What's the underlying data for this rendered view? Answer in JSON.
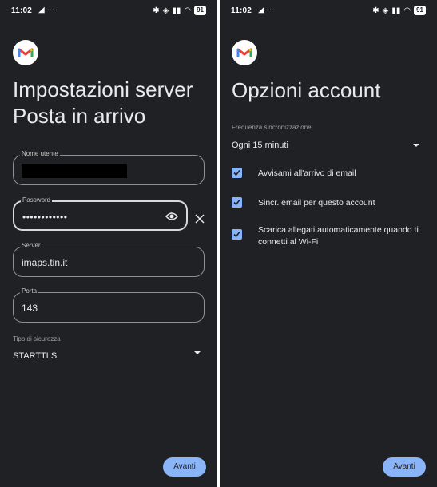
{
  "status_bar": {
    "time": "11:02",
    "left_icons": "◢ ···",
    "battery": "91"
  },
  "left": {
    "title": "Impostazioni server\nPosta in arrivo",
    "username": {
      "label": "Nome utente",
      "value": ""
    },
    "password": {
      "label": "Password",
      "value": "••••••••••••"
    },
    "server": {
      "label": "Server",
      "value": "imaps.tin.it"
    },
    "port": {
      "label": "Porta",
      "value": "143"
    },
    "security": {
      "label": "Tipo di sicurezza",
      "value": "STARTTLS"
    },
    "next_button": "Avanti"
  },
  "right": {
    "title": "Opzioni account",
    "sync": {
      "label": "Frequenza sincronizzazione:",
      "value": "Ogni 15 minuti"
    },
    "options": [
      {
        "label": "Avvisami all'arrivo di email",
        "checked": true
      },
      {
        "label": "Sincr. email per questo account",
        "checked": true
      },
      {
        "label": "Scarica allegati automaticamente quando ti connetti al Wi-Fi",
        "checked": true
      }
    ],
    "next_button": "Avanti"
  },
  "colors": {
    "background": "#202124",
    "accent": "#8ab4f8"
  },
  "icons": [
    "gmail-logo",
    "eye-icon",
    "close-icon",
    "dropdown-arrow-icon",
    "checkbox-icon"
  ]
}
